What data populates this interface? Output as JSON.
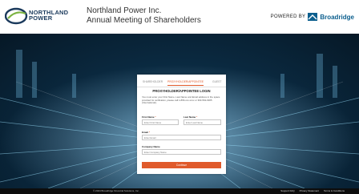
{
  "header": {
    "logo_text_line1": "NORTHLAND",
    "logo_text_line2": "POWER",
    "company": "Northland Power Inc.",
    "meeting": "Annual Meeting of Shareholders",
    "powered_by": "POWERED BY",
    "broadridge": "Broadridge"
  },
  "colors": {
    "accent": "#e05a2b",
    "brand_blue": "#1b3a5c",
    "broadridge_blue": "#0c5f8e"
  },
  "login": {
    "tabs": [
      {
        "label": "SHAREHOLDER",
        "active": false
      },
      {
        "label": "PROXYHOLDER/APPOINTEE",
        "active": true
      },
      {
        "label": "GUEST",
        "active": false
      }
    ],
    "title": "PROXYHOLDER/APPOINTEE LOGIN",
    "description": "You must enter your First Name, Last Name and Email address in the space provided for verification, please call 1-866-xxx-xxxx or 303-562-9305 (International).",
    "first_name_label": "First Name",
    "first_name_placeholder": "Enter First Name",
    "last_name_label": "Last Name",
    "last_name_placeholder": "Enter Last Name",
    "email_label": "Email",
    "email_placeholder": "Enter Email",
    "company_label": "Company Name",
    "company_placeholder": "Enter Company Name",
    "required_mark": "*",
    "continue": "Continue"
  },
  "footer": {
    "copyright": "© 2024 Broadridge Financial Solutions, Inc.",
    "links": [
      "Support FAQ",
      "Privacy Statement",
      "Terms & Conditions"
    ]
  }
}
